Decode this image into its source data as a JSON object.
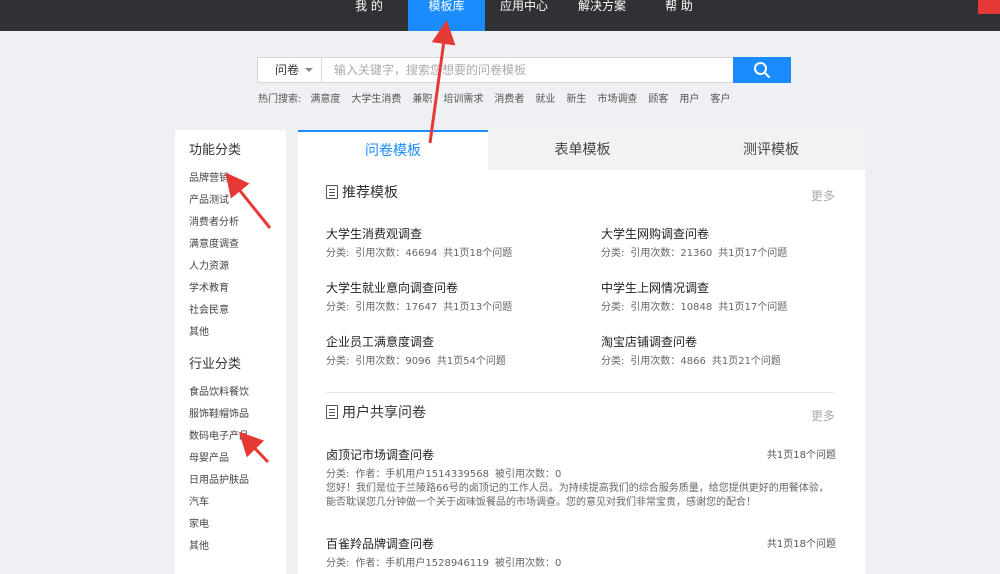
{
  "topnav": {
    "items": [
      {
        "label": "我 的"
      },
      {
        "label": "模板库",
        "active": true
      },
      {
        "label": "应用中心"
      },
      {
        "label": "解决方案"
      },
      {
        "label": "帮 助"
      }
    ]
  },
  "search": {
    "type_label": "问卷",
    "placeholder": "输入关键字，搜索您想要的问卷模板",
    "hot_label": "热门搜索:",
    "hot_terms": [
      "满意度",
      "大学生消费",
      "兼职",
      "培训需求",
      "消费者",
      "就业",
      "新生",
      "市场调查",
      "顾客",
      "用户",
      "客户"
    ]
  },
  "sidebar": {
    "function_title": "功能分类",
    "function_items": [
      "品牌营销",
      "产品测试",
      "消费者分析",
      "满意度调查",
      "人力资源",
      "学术教育",
      "社会民意",
      "其他"
    ],
    "industry_title": "行业分类",
    "industry_items": [
      "食品饮料餐饮",
      "服饰鞋帽饰品",
      "数码电子产品",
      "母婴产品",
      "日用品护肤品",
      "汽车",
      "家电",
      "其他"
    ]
  },
  "tabs": [
    "问卷模板",
    "表单模板",
    "测评模板"
  ],
  "recommended": {
    "title": "推荐模板",
    "more": "更多",
    "cards": [
      {
        "title": "大学生消费观调查",
        "category": "分类:",
        "cites": "引用次数：46694",
        "pages": "共1页18个问题"
      },
      {
        "title": "大学生网购调查问卷",
        "category": "分类:",
        "cites": "引用次数：21360",
        "pages": "共1页17个问题"
      },
      {
        "title": "大学生就业意向调查问卷",
        "category": "分类:",
        "cites": "引用次数：17647",
        "pages": "共1页13个问题"
      },
      {
        "title": "中学生上网情况调查",
        "category": "分类:",
        "cites": "引用次数：10848",
        "pages": "共1页17个问题"
      },
      {
        "title": "企业员工满意度调查",
        "category": "分类:",
        "cites": "引用次数：9096",
        "pages": "共1页54个问题"
      },
      {
        "title": "淘宝店铺调查问卷",
        "category": "分类:",
        "cites": "引用次数：4866",
        "pages": "共1页21个问题"
      }
    ]
  },
  "shared": {
    "title": "用户共享问卷",
    "more": "更多",
    "items": [
      {
        "title": "卤顶记市场调查问卷",
        "count": "共1页18个问题",
        "category": "分类:",
        "author": "作者：手机用户1514339568",
        "cited": "被引用次数：0",
        "desc": "您好！我们是位于兰陵路66号的卤顶记的工作人员。为持续提高我们的综合服务质量，给您提供更好的用餐体验，能否耽误您几分钟做一个关于卤味饭餐品的市场调查。您的意见对我们非常宝贵，感谢您的配合！"
      },
      {
        "title": "百雀羚品牌调查问卷",
        "count": "共1页18个问题",
        "category": "分类:",
        "author": "作者：手机用户1528946119",
        "cited": "被引用次数：0",
        "desc": ""
      }
    ]
  },
  "colors": {
    "accent": "#1a8cff",
    "topbar": "#2f3134",
    "annotation_arrow": "#e53935"
  }
}
